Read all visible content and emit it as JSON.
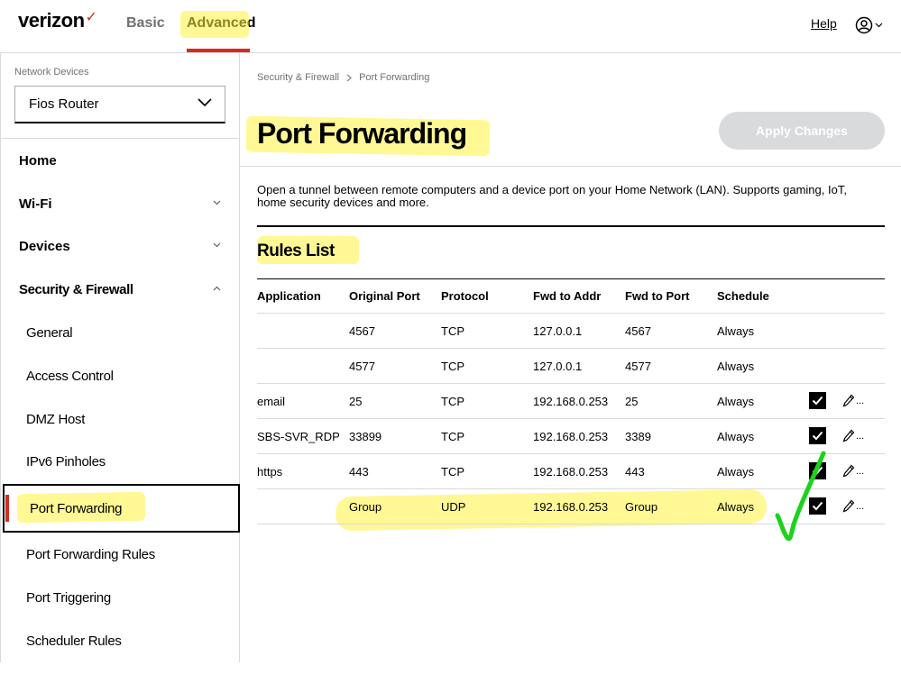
{
  "header": {
    "logo_text": "verizon",
    "logo_check": "✓",
    "tabs": [
      {
        "label": "Basic"
      },
      {
        "label": "Advanced"
      }
    ],
    "help_label": "Help",
    "accent_color": "#d52b1e"
  },
  "sidebar": {
    "network_devices_label": "Network Devices",
    "device_selected": "Fios Router",
    "items": [
      {
        "label": "Home"
      },
      {
        "label": "Wi-Fi"
      },
      {
        "label": "Devices"
      },
      {
        "label": "Security & Firewall"
      }
    ],
    "sub_items": [
      {
        "label": "General"
      },
      {
        "label": "Access Control"
      },
      {
        "label": "DMZ Host"
      },
      {
        "label": "IPv6 Pinholes"
      },
      {
        "label": "Port Forwarding"
      },
      {
        "label": "Port Forwarding Rules"
      },
      {
        "label": "Port Triggering"
      },
      {
        "label": "Scheduler Rules"
      }
    ]
  },
  "breadcrumb": {
    "parent": "Security & Firewall",
    "current": "Port Forwarding"
  },
  "main": {
    "title": "Port Forwarding",
    "apply_label": "Apply Changes",
    "description": "Open a tunnel between remote computers and a device port on your Home Network (LAN). Supports gaming, IoT, home security devices and more.",
    "section_title": "Rules List"
  },
  "table": {
    "headers": [
      "Application",
      "Original Port",
      "Protocol",
      "Fwd to Addr",
      "Fwd to Port",
      "Schedule"
    ],
    "rows": [
      {
        "app": "",
        "orig": "4567",
        "proto": "TCP",
        "addr": "127.0.0.1",
        "fport": "4567",
        "sched": "Always",
        "actions": false
      },
      {
        "app": "",
        "orig": "4577",
        "proto": "TCP",
        "addr": "127.0.0.1",
        "fport": "4577",
        "sched": "Always",
        "actions": false
      },
      {
        "app": "email",
        "orig": "25",
        "proto": "TCP",
        "addr": "192.168.0.253",
        "fport": "25",
        "sched": "Always",
        "actions": true
      },
      {
        "app": "SBS-SVR_RDP",
        "orig": "33899",
        "proto": "TCP",
        "addr": "192.168.0.253",
        "fport": "3389",
        "sched": "Always",
        "actions": true
      },
      {
        "app": "https",
        "orig": "443",
        "proto": "TCP",
        "addr": "192.168.0.253",
        "fport": "443",
        "sched": "Always",
        "actions": true
      },
      {
        "app": "",
        "orig": "Group",
        "proto": "UDP",
        "addr": "192.168.0.253",
        "fport": "Group",
        "sched": "Always",
        "actions": true
      }
    ],
    "more_label": "..."
  }
}
